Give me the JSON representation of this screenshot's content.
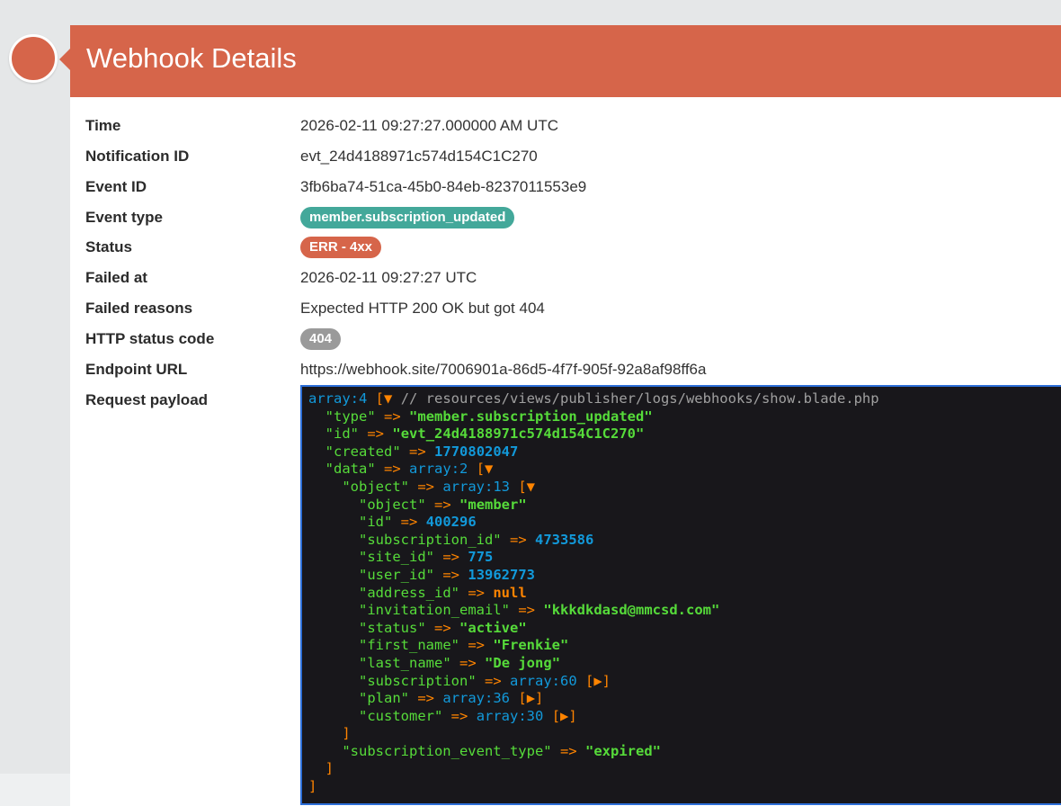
{
  "panel": {
    "title": "Webhook Details"
  },
  "details": {
    "time": {
      "label": "Time",
      "value": "2026-02-11 09:27:27.000000 AM UTC"
    },
    "notification_id": {
      "label": "Notification ID",
      "value": "evt_24d4188971c574d154C1C270"
    },
    "event_id": {
      "label": "Event ID",
      "value": "3fb6ba74-51ca-45b0-84eb-8237011553e9"
    },
    "event_type": {
      "label": "Event type",
      "value": "member.subscription_updated"
    },
    "status": {
      "label": "Status",
      "value": "ERR - 4xx"
    },
    "failed_at": {
      "label": "Failed at",
      "value": "2026-02-11 09:27:27 UTC"
    },
    "failed_reasons": {
      "label": "Failed reasons",
      "value": "Expected HTTP 200 OK but got 404"
    },
    "http_status_code": {
      "label": "HTTP status code",
      "value": "404"
    },
    "endpoint_url": {
      "label": "Endpoint URL",
      "value": "https://webhook.site/7006901a-86d5-4f7f-905f-92a8af98ff6a"
    },
    "request_payload": {
      "label": "Request payload"
    }
  },
  "payload": {
    "header": {
      "type": "array:4",
      "comment": "// resources/views/publisher/logs/webhooks/show.blade.php"
    },
    "type": "member.subscription_updated",
    "id": "evt_24d4188971c574d154C1C270",
    "created": "1770802047",
    "data_type": "array:2",
    "object_type": "array:13",
    "object": {
      "object": "member",
      "id": "400296",
      "subscription_id": "4733586",
      "site_id": "775",
      "user_id": "13962773",
      "address_id": "null",
      "invitation_email": "kkkdkdasd@mmcsd.com",
      "status": "active",
      "first_name": "Frenkie",
      "last_name": "De jong",
      "subscription": "array:60",
      "plan": "array:36",
      "customer": "array:30"
    },
    "subscription_event_type": "expired"
  },
  "colors": {
    "accent": "#d6654a",
    "teal_badge": "#43a89a",
    "grey_badge": "#9a9a9a",
    "dump_bg": "#18171b",
    "dump_border": "#2d6fd8"
  }
}
